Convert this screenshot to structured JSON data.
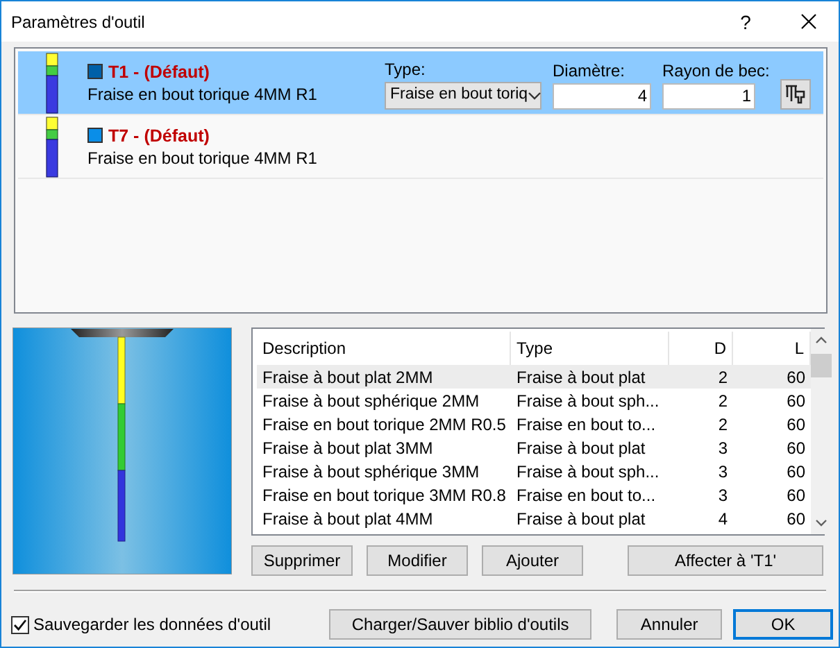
{
  "window": {
    "title": "Paramètres d'outil",
    "help": "?"
  },
  "tools": [
    {
      "name": "T1 - (Défaut)",
      "description": "Fraise en bout torique 4MM R1",
      "color": "#0060a8",
      "selected": true
    },
    {
      "name": "T7 - (Défaut)",
      "description": "Fraise en bout torique 4MM R1",
      "color": "#0a8ee8",
      "selected": false
    }
  ],
  "editor": {
    "type_label": "Type:",
    "type_value": "Fraise en bout toriq",
    "diameter_label": "Diamètre:",
    "diameter_value": "4",
    "radius_label": "Rayon de bec:",
    "radius_value": "1"
  },
  "library": {
    "columns": [
      "Description",
      "Type",
      "D",
      "L"
    ],
    "rows": [
      {
        "cells": [
          "Fraise à bout plat 2MM",
          "Fraise à bout plat",
          "2",
          "60"
        ],
        "selected": true
      },
      {
        "cells": [
          "Fraise à bout sphérique 2MM",
          "Fraise à bout sph...",
          "2",
          "60"
        ],
        "selected": false
      },
      {
        "cells": [
          "Fraise en bout torique 2MM R0.5",
          "Fraise en bout to...",
          "2",
          "60"
        ],
        "selected": false
      },
      {
        "cells": [
          "Fraise à bout plat 3MM",
          "Fraise à bout plat",
          "3",
          "60"
        ],
        "selected": false
      },
      {
        "cells": [
          "Fraise à bout sphérique 3MM",
          "Fraise à bout sph...",
          "3",
          "60"
        ],
        "selected": false
      },
      {
        "cells": [
          "Fraise en bout torique 3MM R0.8",
          "Fraise en bout to...",
          "3",
          "60"
        ],
        "selected": false
      },
      {
        "cells": [
          "Fraise à bout plat 4MM",
          "Fraise à bout plat",
          "4",
          "60"
        ],
        "selected": false
      }
    ],
    "buttons": [
      "Supprimer",
      "Modifier",
      "Ajouter",
      "Affecter à 'T1'"
    ]
  },
  "save_option": {
    "label": "Sauvegarder les données d'outil",
    "checked": true
  },
  "footer_buttons": [
    {
      "label": "Charger/Sauver biblio d'outils",
      "default": false
    },
    {
      "label": "Annuler",
      "default": false
    },
    {
      "label": "OK",
      "default": true
    }
  ]
}
